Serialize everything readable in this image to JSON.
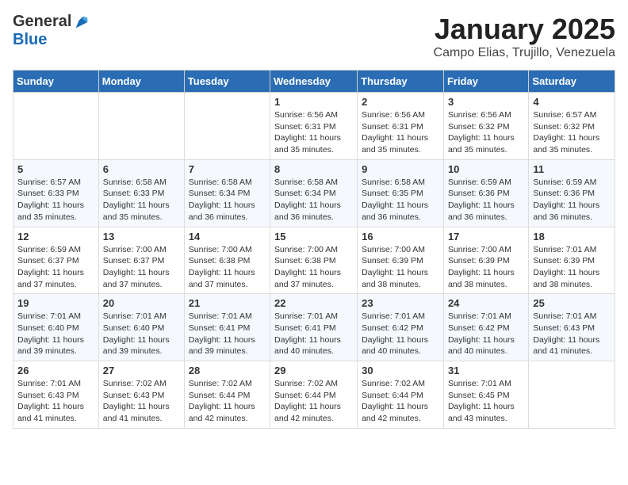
{
  "header": {
    "logo_general": "General",
    "logo_blue": "Blue",
    "month": "January 2025",
    "location": "Campo Elias, Trujillo, Venezuela"
  },
  "weekdays": [
    "Sunday",
    "Monday",
    "Tuesday",
    "Wednesday",
    "Thursday",
    "Friday",
    "Saturday"
  ],
  "weeks": [
    [
      {
        "day": "",
        "info": ""
      },
      {
        "day": "",
        "info": ""
      },
      {
        "day": "",
        "info": ""
      },
      {
        "day": "1",
        "info": "Sunrise: 6:56 AM\nSunset: 6:31 PM\nDaylight: 11 hours and 35 minutes."
      },
      {
        "day": "2",
        "info": "Sunrise: 6:56 AM\nSunset: 6:31 PM\nDaylight: 11 hours and 35 minutes."
      },
      {
        "day": "3",
        "info": "Sunrise: 6:56 AM\nSunset: 6:32 PM\nDaylight: 11 hours and 35 minutes."
      },
      {
        "day": "4",
        "info": "Sunrise: 6:57 AM\nSunset: 6:32 PM\nDaylight: 11 hours and 35 minutes."
      }
    ],
    [
      {
        "day": "5",
        "info": "Sunrise: 6:57 AM\nSunset: 6:33 PM\nDaylight: 11 hours and 35 minutes."
      },
      {
        "day": "6",
        "info": "Sunrise: 6:58 AM\nSunset: 6:33 PM\nDaylight: 11 hours and 35 minutes."
      },
      {
        "day": "7",
        "info": "Sunrise: 6:58 AM\nSunset: 6:34 PM\nDaylight: 11 hours and 36 minutes."
      },
      {
        "day": "8",
        "info": "Sunrise: 6:58 AM\nSunset: 6:34 PM\nDaylight: 11 hours and 36 minutes."
      },
      {
        "day": "9",
        "info": "Sunrise: 6:58 AM\nSunset: 6:35 PM\nDaylight: 11 hours and 36 minutes."
      },
      {
        "day": "10",
        "info": "Sunrise: 6:59 AM\nSunset: 6:36 PM\nDaylight: 11 hours and 36 minutes."
      },
      {
        "day": "11",
        "info": "Sunrise: 6:59 AM\nSunset: 6:36 PM\nDaylight: 11 hours and 36 minutes."
      }
    ],
    [
      {
        "day": "12",
        "info": "Sunrise: 6:59 AM\nSunset: 6:37 PM\nDaylight: 11 hours and 37 minutes."
      },
      {
        "day": "13",
        "info": "Sunrise: 7:00 AM\nSunset: 6:37 PM\nDaylight: 11 hours and 37 minutes."
      },
      {
        "day": "14",
        "info": "Sunrise: 7:00 AM\nSunset: 6:38 PM\nDaylight: 11 hours and 37 minutes."
      },
      {
        "day": "15",
        "info": "Sunrise: 7:00 AM\nSunset: 6:38 PM\nDaylight: 11 hours and 37 minutes."
      },
      {
        "day": "16",
        "info": "Sunrise: 7:00 AM\nSunset: 6:39 PM\nDaylight: 11 hours and 38 minutes."
      },
      {
        "day": "17",
        "info": "Sunrise: 7:00 AM\nSunset: 6:39 PM\nDaylight: 11 hours and 38 minutes."
      },
      {
        "day": "18",
        "info": "Sunrise: 7:01 AM\nSunset: 6:39 PM\nDaylight: 11 hours and 38 minutes."
      }
    ],
    [
      {
        "day": "19",
        "info": "Sunrise: 7:01 AM\nSunset: 6:40 PM\nDaylight: 11 hours and 39 minutes."
      },
      {
        "day": "20",
        "info": "Sunrise: 7:01 AM\nSunset: 6:40 PM\nDaylight: 11 hours and 39 minutes."
      },
      {
        "day": "21",
        "info": "Sunrise: 7:01 AM\nSunset: 6:41 PM\nDaylight: 11 hours and 39 minutes."
      },
      {
        "day": "22",
        "info": "Sunrise: 7:01 AM\nSunset: 6:41 PM\nDaylight: 11 hours and 40 minutes."
      },
      {
        "day": "23",
        "info": "Sunrise: 7:01 AM\nSunset: 6:42 PM\nDaylight: 11 hours and 40 minutes."
      },
      {
        "day": "24",
        "info": "Sunrise: 7:01 AM\nSunset: 6:42 PM\nDaylight: 11 hours and 40 minutes."
      },
      {
        "day": "25",
        "info": "Sunrise: 7:01 AM\nSunset: 6:43 PM\nDaylight: 11 hours and 41 minutes."
      }
    ],
    [
      {
        "day": "26",
        "info": "Sunrise: 7:01 AM\nSunset: 6:43 PM\nDaylight: 11 hours and 41 minutes."
      },
      {
        "day": "27",
        "info": "Sunrise: 7:02 AM\nSunset: 6:43 PM\nDaylight: 11 hours and 41 minutes."
      },
      {
        "day": "28",
        "info": "Sunrise: 7:02 AM\nSunset: 6:44 PM\nDaylight: 11 hours and 42 minutes."
      },
      {
        "day": "29",
        "info": "Sunrise: 7:02 AM\nSunset: 6:44 PM\nDaylight: 11 hours and 42 minutes."
      },
      {
        "day": "30",
        "info": "Sunrise: 7:02 AM\nSunset: 6:44 PM\nDaylight: 11 hours and 42 minutes."
      },
      {
        "day": "31",
        "info": "Sunrise: 7:01 AM\nSunset: 6:45 PM\nDaylight: 11 hours and 43 minutes."
      },
      {
        "day": "",
        "info": ""
      }
    ]
  ]
}
